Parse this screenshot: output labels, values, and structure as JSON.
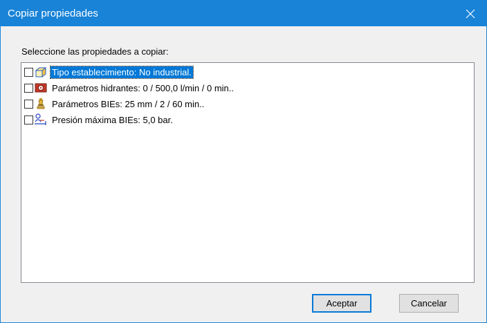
{
  "dialog": {
    "title": "Copiar propiedades",
    "prompt": "Seleccione las propiedades a copiar:"
  },
  "properties": [
    {
      "label": "Tipo establecimiento: No industrial.",
      "checked": false,
      "selected": true,
      "icon": "building-box-icon"
    },
    {
      "label": "Parámetros hidrantes: 0 / 500,0 l/min / 0 min..",
      "checked": false,
      "selected": false,
      "icon": "hydrant-icon"
    },
    {
      "label": "Parámetros BIEs: 25 mm / 2  / 60 min..",
      "checked": false,
      "selected": false,
      "icon": "hose-nozzle-icon"
    },
    {
      "label": "Presión máxima BIEs: 5,0 bar.",
      "checked": false,
      "selected": false,
      "icon": "pressure-person-icon"
    }
  ],
  "buttons": {
    "accept": "Aceptar",
    "cancel": "Cancelar"
  },
  "colors": {
    "titlebar": "#1883d7",
    "selection": "#0078d7",
    "dialog_bg": "#f0f0f0"
  }
}
